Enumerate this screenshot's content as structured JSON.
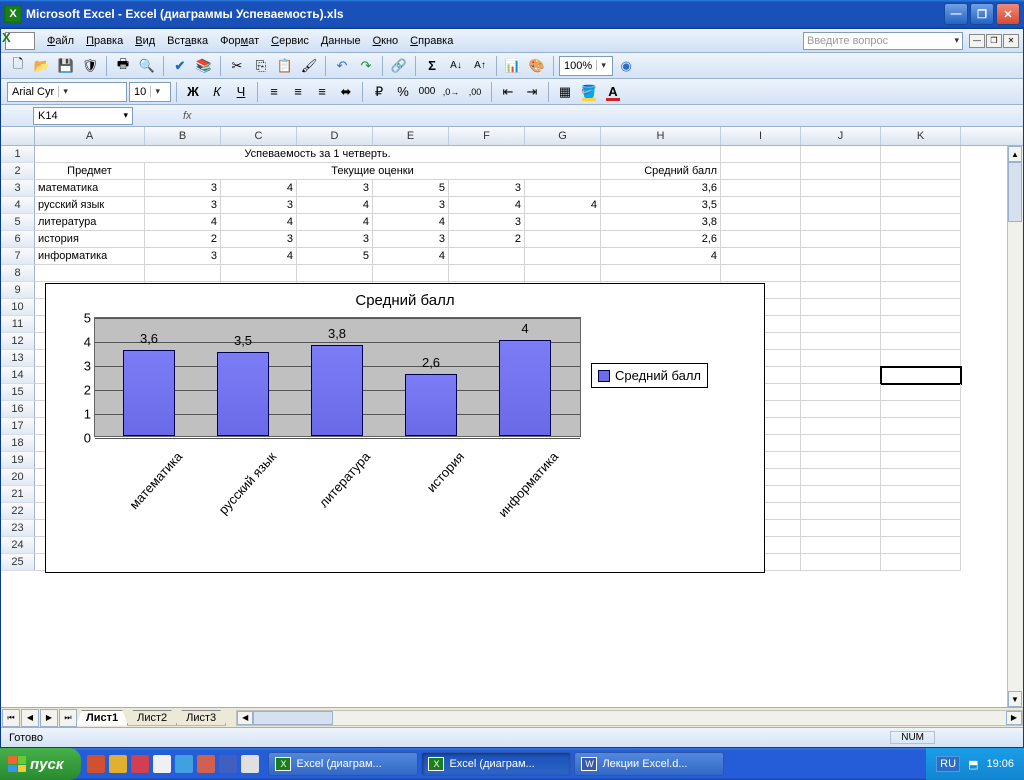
{
  "window": {
    "title": "Microsoft Excel - Excel (диаграммы Успеваемость).xls"
  },
  "menu": {
    "file": "Файл",
    "edit": "Правка",
    "view": "Вид",
    "insert": "Вставка",
    "format": "Формат",
    "tools": "Сервис",
    "data": "Данные",
    "window": "Окно",
    "help": "Справка"
  },
  "question": "Введите вопрос",
  "font": {
    "name": "Arial Cyr",
    "size": "10"
  },
  "zoom": "100%",
  "namebox": "K14",
  "columns": [
    "A",
    "B",
    "C",
    "D",
    "E",
    "F",
    "G",
    "H",
    "I",
    "J",
    "K"
  ],
  "tabledata": {
    "title": "Успеваемость за 1 четверть.",
    "col_subject": "Предмет",
    "col_grades": "Текущие оценки",
    "col_avg": "Средний балл",
    "rows": [
      {
        "subj": "математика",
        "g": [
          "3",
          "4",
          "3",
          "5",
          "3",
          ""
        ],
        "avg": "3,6"
      },
      {
        "subj": "русский язык",
        "g": [
          "3",
          "3",
          "4",
          "3",
          "4",
          "4"
        ],
        "avg": "3,5"
      },
      {
        "subj": "литература",
        "g": [
          "4",
          "4",
          "4",
          "4",
          "3",
          ""
        ],
        "avg": "3,8"
      },
      {
        "subj": "история",
        "g": [
          "2",
          "3",
          "3",
          "3",
          "2",
          ""
        ],
        "avg": "2,6"
      },
      {
        "subj": "информатика",
        "g": [
          "3",
          "4",
          "5",
          "4",
          "",
          ""
        ],
        "avg": "4"
      }
    ]
  },
  "chart_data": {
    "type": "bar",
    "title": "Средний балл",
    "legend": "Средний балл",
    "categories": [
      "математика",
      "русский язык",
      "литература",
      "история",
      "информатика"
    ],
    "values": [
      3.6,
      3.5,
      3.8,
      2.6,
      4
    ],
    "data_labels": [
      "3,6",
      "3,5",
      "3,8",
      "2,6",
      "4"
    ],
    "ylim": [
      0,
      5
    ],
    "yticks": [
      0,
      1,
      2,
      3,
      4,
      5
    ]
  },
  "sheets": {
    "s1": "Лист1",
    "s2": "Лист2",
    "s3": "Лист3"
  },
  "status": {
    "ready": "Готово",
    "num": "NUM"
  },
  "taskbar": {
    "start": "пуск",
    "t1": "Excel (диаграм...",
    "t2": "Excel (диаграм...",
    "t3": "Лекции Excel.d...",
    "lang": "RU",
    "time": "19:06"
  },
  "colwidths": {
    "A": 110,
    "B": 76,
    "C": 76,
    "D": 76,
    "E": 76,
    "F": 76,
    "G": 76,
    "H": 120,
    "I": 80,
    "J": 80,
    "K": 80
  }
}
